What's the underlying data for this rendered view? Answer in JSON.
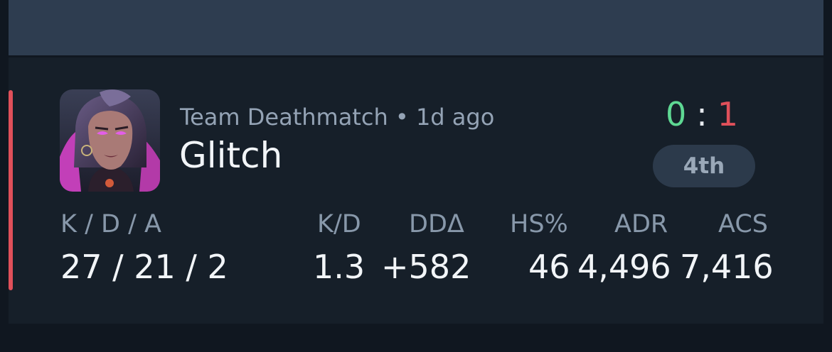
{
  "previous_match": {
    "kd": "1.3",
    "dda": "+582",
    "hs": "46",
    "adr": "4.496",
    "acs": "7.416"
  },
  "match": {
    "mode": "Team Deathmatch",
    "separator": "•",
    "time_ago": "1d ago",
    "agent_name": "Glitch",
    "agent_icon": "agent-portrait",
    "score_team": "0",
    "score_sep": ":",
    "score_enemy": "1",
    "placement": "4th",
    "result_color": "#e0505a",
    "stats": {
      "kda_label": "K / D / A",
      "kda_value": "27 / 21 / 2",
      "kd_label": "K/D",
      "kd_value": "1.3",
      "dda_label": "DDΔ",
      "dda_value": "+582",
      "hs_label": "HS%",
      "hs_value": "46",
      "adr_label": "ADR",
      "adr_value": "4,496",
      "acs_label": "ACS",
      "acs_value": "7,416"
    }
  },
  "colors": {
    "positive": "#5ed893",
    "negative": "#e0505a",
    "card_bg": "#161f29",
    "page_bg": "#101720"
  }
}
